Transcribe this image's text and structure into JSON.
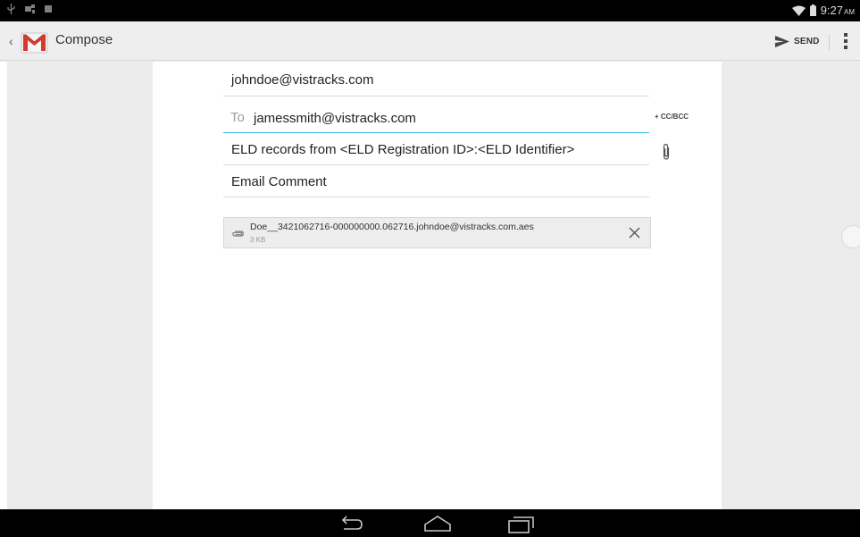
{
  "status_bar": {
    "icons": [
      "usb-icon",
      "android-debug-icon",
      "notification-square-icon",
      "wifi-icon",
      "battery-icon"
    ],
    "time": "9:27",
    "ampm": "AM"
  },
  "action_bar": {
    "title": "Compose",
    "send_label": "SEND",
    "icons": [
      "up-caret-icon",
      "gmail-logo-icon",
      "send-icon",
      "overflow-menu-icon"
    ]
  },
  "compose": {
    "from": "johndoe@vistracks.com",
    "to_label": "To",
    "to": "jamessmith@vistracks.com",
    "cc_bcc": "+ CC/BCC",
    "subject": "ELD records from <ELD Registration ID>:<ELD Identifier>",
    "comment": "Email Comment"
  },
  "attachment": {
    "name": "Doe__3421062716-000000000.062716.johndoe@vistracks.com.aes",
    "size": "3 KB"
  },
  "nav_bar": {
    "icons": [
      "back-icon",
      "home-icon",
      "recents-icon"
    ]
  },
  "colors": {
    "focus_accent": "#33b5e5",
    "gmail_red": "#d7392c",
    "status_bar_bg": "#000000"
  }
}
